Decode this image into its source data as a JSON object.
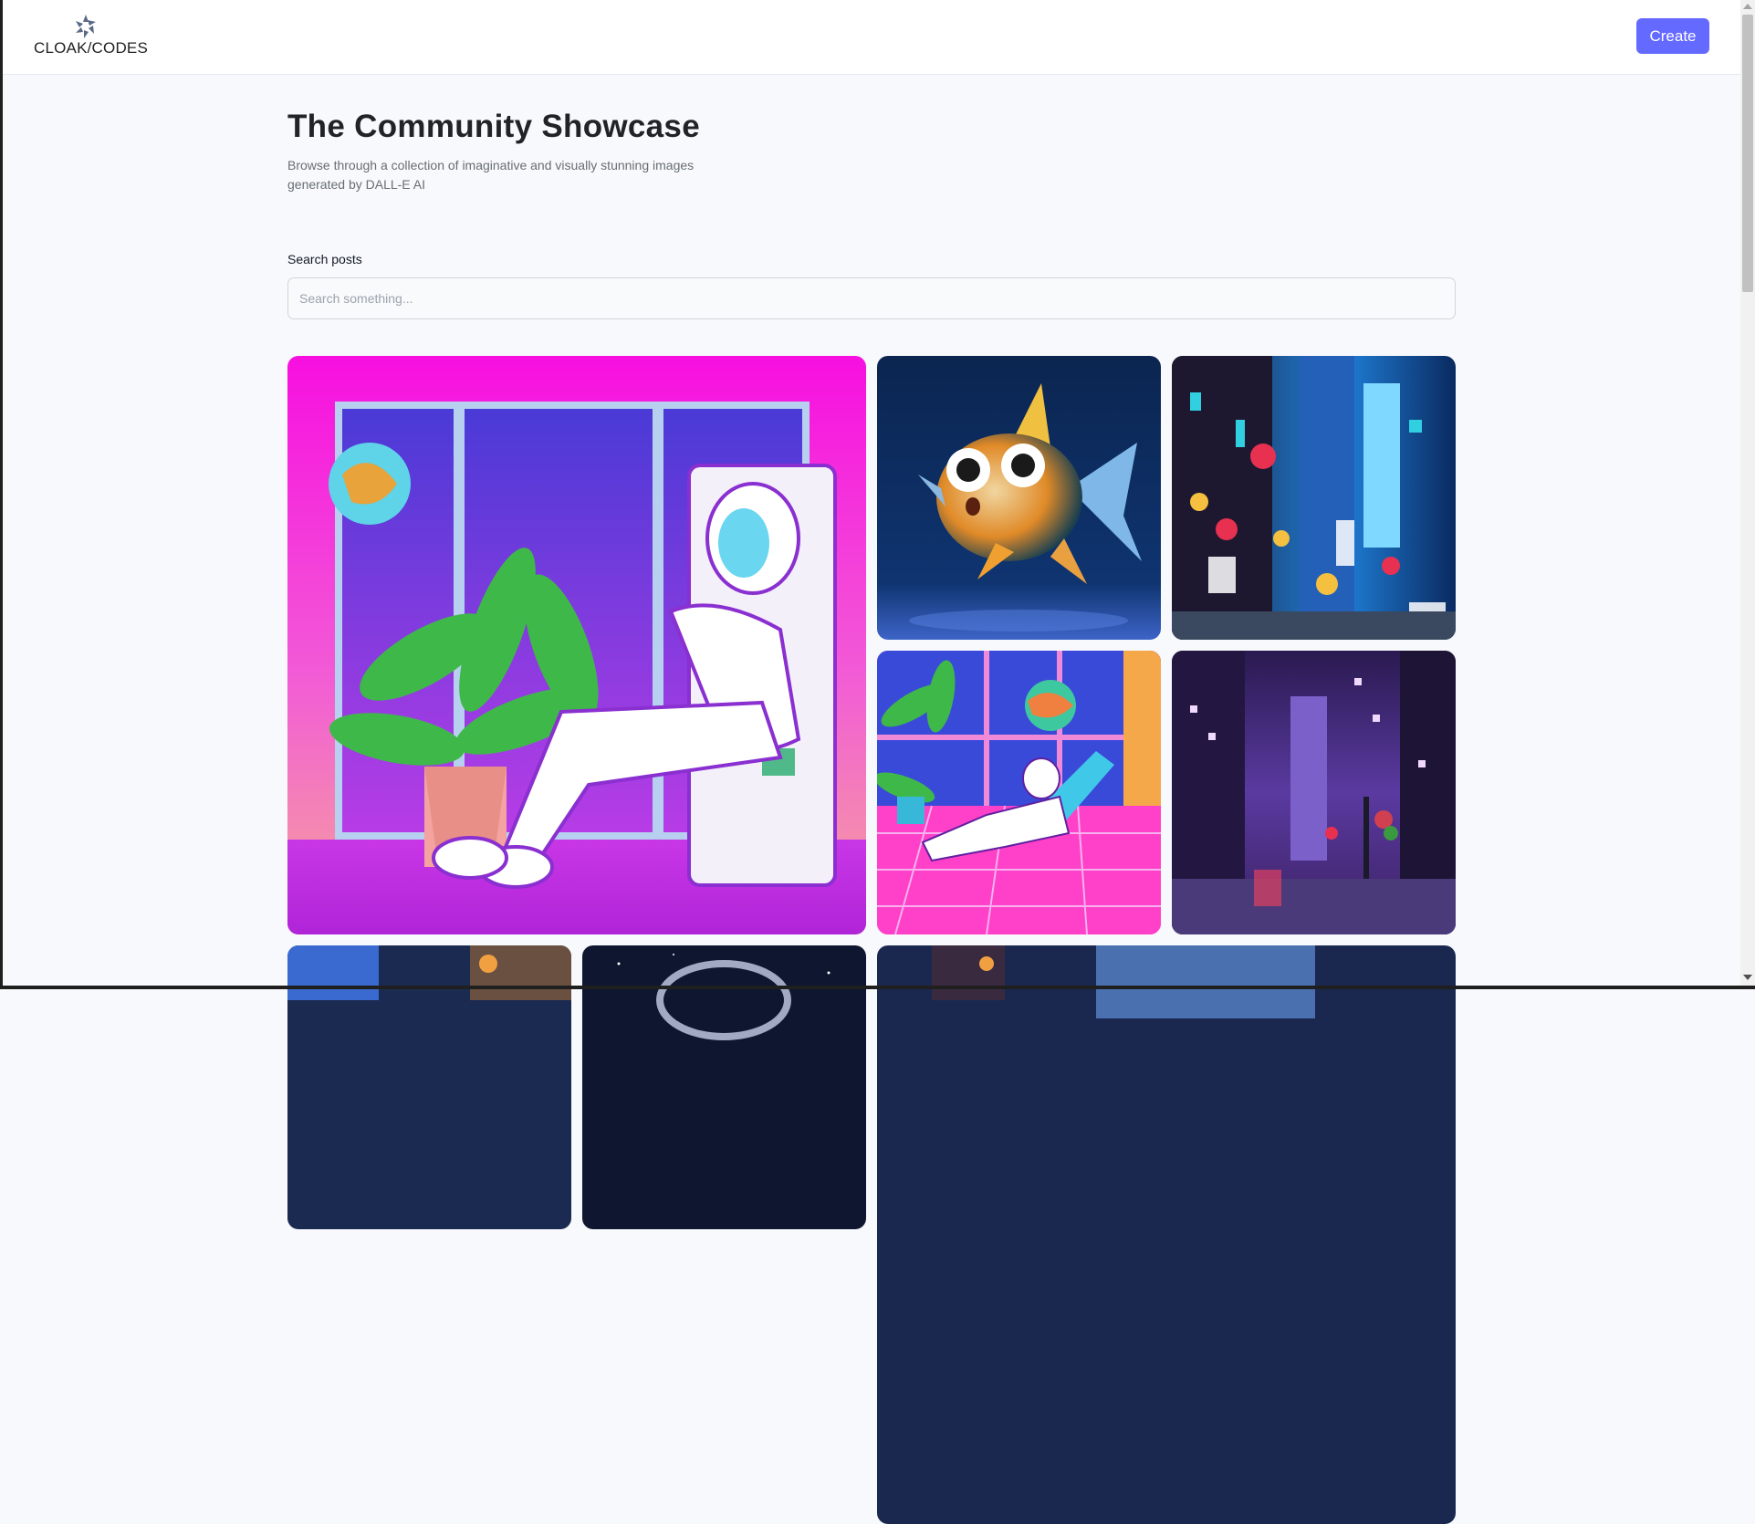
{
  "header": {
    "logo_text": "CLOAK/CODES",
    "create_label": "Create"
  },
  "main": {
    "title": "The Community Showcase",
    "subtitle": "Browse through a collection of imaginative and visually stunning images generated by DALL-E AI",
    "search": {
      "label": "Search posts",
      "placeholder": "Search something...",
      "value": ""
    }
  },
  "colors": {
    "accent": "#6469ff",
    "title": "#222328",
    "subtitle": "#666e75",
    "page_bg": "#f8f9fc"
  }
}
